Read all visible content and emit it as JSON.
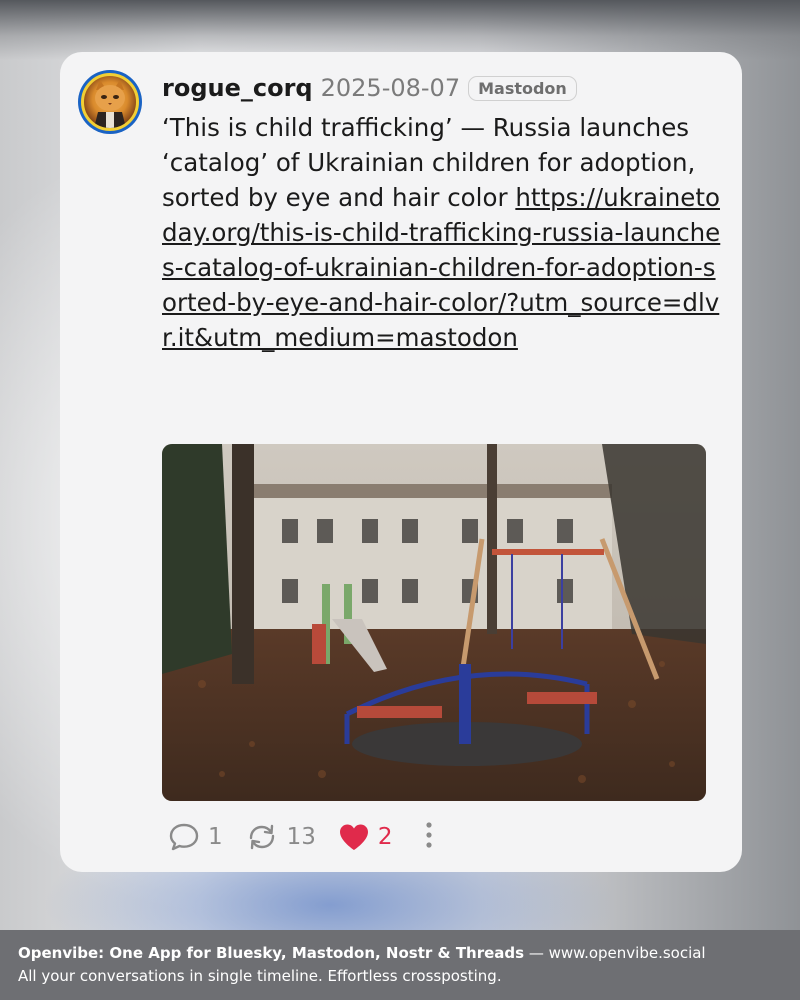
{
  "post": {
    "username": "rogue_corq",
    "date": "2025-08-07",
    "network": "Mastodon",
    "text": "‘This is child trafficking’ — Russia launches ‘catalog’ of Ukrainian children for adoption, sorted by eye and hair color",
    "link": "https://ukrainetoday.org/this-is-child-trafficking-russia-launches-catalog-of-ukrainian-children-for-adoption-sorted-by-eye-and-hair-color/?utm_source=dlvr.it&utm_medium=mastodon",
    "stats": {
      "replies": "1",
      "reposts": "13",
      "likes": "2"
    }
  },
  "footer": {
    "brand": "Openvibe: One App for Bluesky, Mastodon, Nostr & Threads",
    "separator": " — ",
    "url": "www.openvibe.social",
    "tagline": "All your conversations in single timeline. Effortless crossposting."
  },
  "colors": {
    "like": "#e02a4b",
    "avatar_ring": "#1a63c4",
    "avatar_inner_ring": "#f2cf34",
    "card": "#f4f4f5",
    "footer": "#6e6f73"
  },
  "icons": {
    "reply": "speech-bubble-icon",
    "repost": "repost-arrows-icon",
    "like": "heart-icon",
    "more": "vertical-ellipsis-icon"
  }
}
